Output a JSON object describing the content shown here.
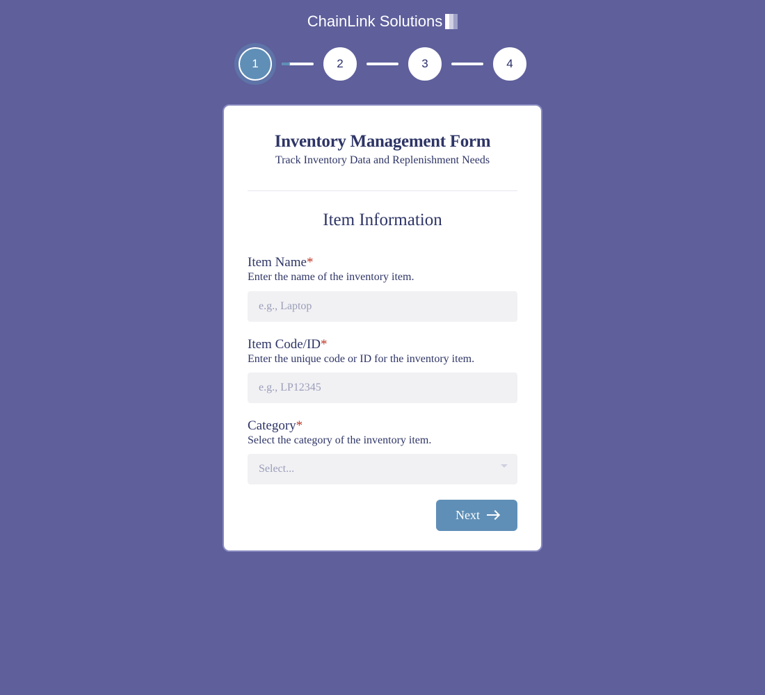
{
  "brand": {
    "name": "ChainLink Solutions"
  },
  "stepper": {
    "steps": [
      "1",
      "2",
      "3",
      "4"
    ],
    "activeIndex": 0
  },
  "form": {
    "title": "Inventory Management Form",
    "subtitle": "Track Inventory Data and Replenishment Needs",
    "section_heading": "Item Information",
    "fields": {
      "item_name": {
        "label": "Item Name",
        "required_marker": "*",
        "help": "Enter the name of the inventory item.",
        "placeholder": "e.g., Laptop",
        "value": ""
      },
      "item_code": {
        "label": "Item Code/ID",
        "required_marker": "*",
        "help": "Enter the unique code or ID for the inventory item.",
        "placeholder": "e.g., LP12345",
        "value": ""
      },
      "category": {
        "label": "Category",
        "required_marker": "*",
        "help": "Select the category of the inventory item.",
        "selected": "Select..."
      }
    },
    "actions": {
      "next_label": "Next"
    }
  },
  "colors": {
    "background": "#5e5f9b",
    "accent": "#5f8fb7",
    "text_dark": "#2e3566",
    "required": "#c0392b"
  }
}
